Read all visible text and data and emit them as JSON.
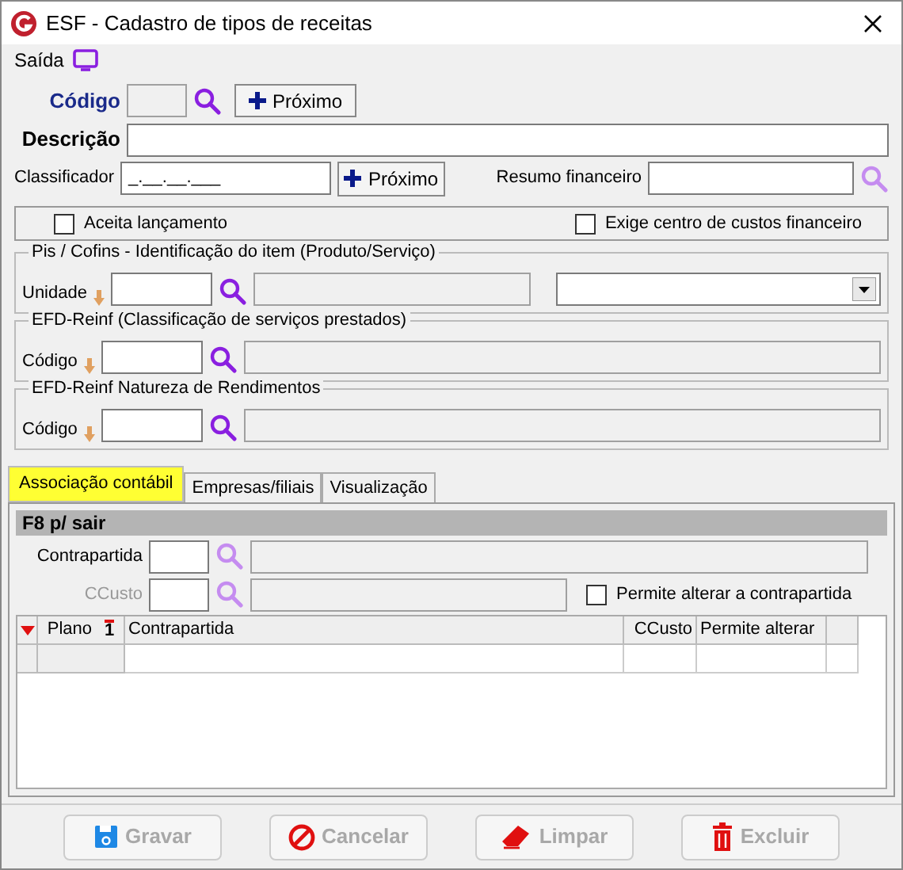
{
  "window": {
    "title": "ESF - Cadastro de tipos de receitas"
  },
  "menu": [
    {
      "label": "Saída"
    }
  ],
  "codigo": {
    "label": "Código",
    "button": "Próximo"
  },
  "descricao": {
    "label": "Descrição"
  },
  "classificador": {
    "label": "Classificador",
    "value": "_.__.__.___",
    "button": "Próximo"
  },
  "resumo": {
    "label": "Resumo financeiro"
  },
  "options": [
    {
      "label": "Aceita lançamento",
      "checked": false
    },
    {
      "label": "Exige centro de custos financeiro",
      "checked": false
    }
  ],
  "groups": [
    {
      "title": "Pis / Cofins - Identificação do item (Produto/Serviço)",
      "label": "Unidade",
      "dropdown": true
    },
    {
      "title": "EFD-Reinf (Classificação de serviços prestados)",
      "label": "Código",
      "dropdown": false
    },
    {
      "title": "EFD-Reinf Natureza de Rendimentos",
      "label": "Código",
      "dropdown": false
    }
  ],
  "tabs": [
    {
      "label": "Associação contábil",
      "selected": true
    },
    {
      "label": "Empresas/filiais",
      "selected": false
    },
    {
      "label": "Visualização",
      "selected": false
    }
  ],
  "panel": {
    "header": "F8 p/ sair",
    "contrapartida": {
      "label": "Contrapartida",
      "disabled": false
    },
    "ccusto": {
      "label": "CCusto",
      "disabled": true
    },
    "permite": {
      "label": "Permite alterar a contrapartida",
      "checked": false
    }
  },
  "grid": {
    "columns": [
      "Plano",
      "Contrapartida",
      "CCusto",
      "Permite alterar"
    ],
    "sort_mark": "1"
  },
  "buttons": [
    {
      "label": "Gravar",
      "kind": "save",
      "disabled": true
    },
    {
      "label": "Cancelar",
      "kind": "cancel",
      "disabled": true
    },
    {
      "label": "Limpar",
      "kind": "clear",
      "disabled": true
    },
    {
      "label": "Excluir",
      "kind": "delete",
      "disabled": true
    }
  ]
}
